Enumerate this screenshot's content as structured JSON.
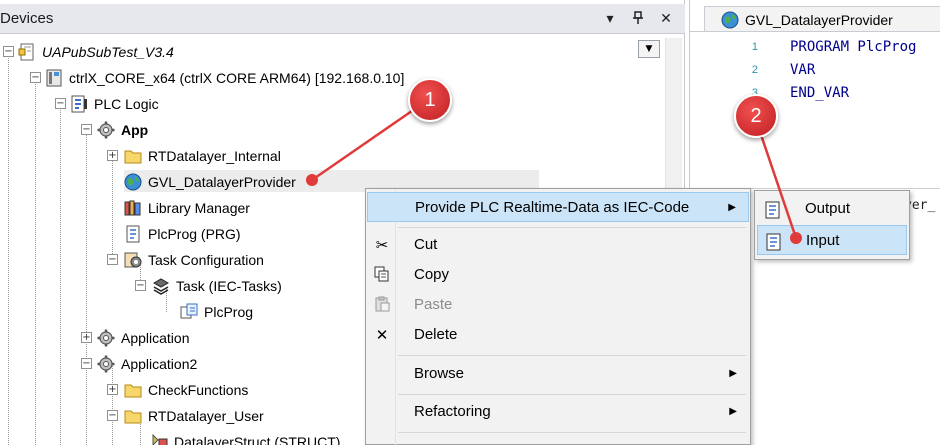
{
  "devices_panel": {
    "title": "Devices",
    "header_buttons": {
      "dropdown": "▾",
      "pin": "⊣",
      "close": "✕"
    },
    "tree_dropdown": "▼"
  },
  "tree": {
    "items": [
      {
        "label": "UAPubSubTest_V3.4",
        "icon": "project-icon"
      },
      {
        "label": "ctrlX_CORE_x64 (ctrlX CORE ARM64) [192.168.0.10]",
        "icon": "device-icon"
      },
      {
        "label": "PLC Logic",
        "icon": "plc-logic-icon"
      },
      {
        "label": "App",
        "icon": "application-gear-icon"
      },
      {
        "label": "RTDatalayer_Internal",
        "icon": "folder-icon"
      },
      {
        "label": "GVL_DatalayerProvider",
        "icon": "globe-icon"
      },
      {
        "label": "Library Manager",
        "icon": "library-icon"
      },
      {
        "label": "PlcProg (PRG)",
        "icon": "pou-icon"
      },
      {
        "label": "Task Configuration",
        "icon": "task-config-icon"
      },
      {
        "label": "Task (IEC-Tasks)",
        "icon": "task-icon"
      },
      {
        "label": "PlcProg",
        "icon": "program-call-icon"
      },
      {
        "label": "Application",
        "icon": "application-gear-icon"
      },
      {
        "label": "Application2",
        "icon": "application-gear-icon"
      },
      {
        "label": "CheckFunctions",
        "icon": "folder-icon"
      },
      {
        "label": "RTDatalayer_User",
        "icon": "folder-icon"
      },
      {
        "label": "DatalayerStruct (STRUCT)",
        "icon": "struct-icon"
      }
    ]
  },
  "editor": {
    "tab_title": "GVL_DatalayerProvider",
    "lines": [
      {
        "no": "1",
        "code": "PROGRAM PlcProg"
      },
      {
        "no": "2",
        "code": "VAR"
      },
      {
        "no": "3",
        "code": "END_VAR"
      }
    ],
    "bottom_text": "yer_"
  },
  "context_menu": {
    "items": [
      {
        "label": "Provide PLC Realtime-Data as IEC-Code",
        "icon": "",
        "arrow": "▶"
      },
      {
        "label": "Cut",
        "icon": "✂"
      },
      {
        "label": "Copy",
        "icon": "⎘"
      },
      {
        "label": "Paste",
        "icon": "📋"
      },
      {
        "label": "Delete",
        "icon": "✕"
      },
      {
        "label": "Browse",
        "icon": "",
        "arrow": "▶"
      },
      {
        "label": "Refactoring",
        "icon": "",
        "arrow": "▶"
      }
    ]
  },
  "submenu": {
    "items": [
      {
        "label": "Output",
        "icon": "document-icon"
      },
      {
        "label": "Input",
        "icon": "document-icon"
      }
    ]
  },
  "callouts": {
    "one": "1",
    "two": "2"
  },
  "colors": {
    "highlight": "#cce4f7",
    "highlight_border": "#99c9ef",
    "callout": "#e03a3a",
    "keyword": "#00008b",
    "line_number": "#2b91af"
  }
}
